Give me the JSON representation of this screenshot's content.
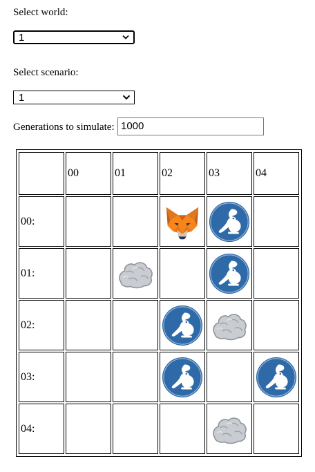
{
  "form": {
    "world_label": "Select world:",
    "world_value": "1",
    "scenario_label": "Select scenario:",
    "scenario_value": "1",
    "generations_label": "Generations to simulate:",
    "generations_value": "1000"
  },
  "grid": {
    "column_headers": [
      "00",
      "01",
      "02",
      "03",
      "04"
    ],
    "row_headers": [
      "00:",
      "01:",
      "02:",
      "03:",
      "04:"
    ],
    "cells": [
      [
        "",
        "",
        "fox",
        "rabbit",
        ""
      ],
      [
        "",
        "rock",
        "",
        "rabbit",
        ""
      ],
      [
        "",
        "",
        "rabbit",
        "rock",
        ""
      ],
      [
        "",
        "",
        "rabbit",
        "",
        "rabbit"
      ],
      [
        "",
        "",
        "",
        "rock",
        ""
      ]
    ]
  },
  "icons": {
    "fox": "fox-icon",
    "rabbit": "rabbit-icon",
    "rock": "rock-icon"
  },
  "colors": {
    "rabbit_bg": "#2f6aa8",
    "fox_orange": "#e8761e",
    "rock_gray": "#c9ccd0"
  }
}
